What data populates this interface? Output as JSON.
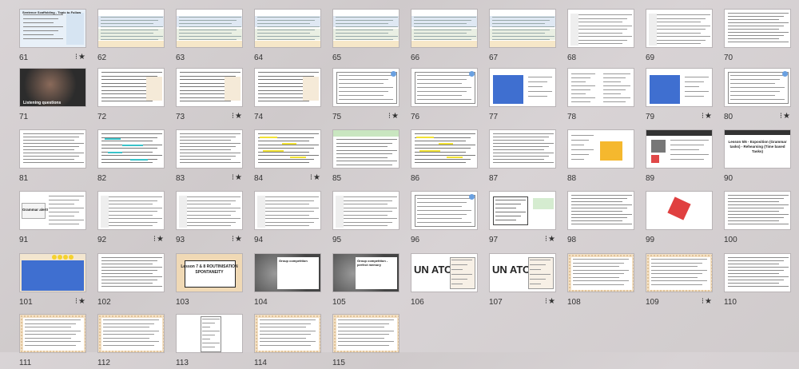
{
  "slides": [
    {
      "n": "61",
      "style": "table",
      "bg": "#e8f0f8",
      "title": "Sentence Scaffolding - Topic to Follow",
      "flag": "⁝★"
    },
    {
      "n": "62",
      "style": "bands",
      "bg": "#fff",
      "flag": ""
    },
    {
      "n": "63",
      "style": "bands",
      "bg": "#fff",
      "flag": ""
    },
    {
      "n": "64",
      "style": "bands",
      "bg": "#fff",
      "flag": ""
    },
    {
      "n": "65",
      "style": "bands",
      "bg": "#fff",
      "flag": ""
    },
    {
      "n": "66",
      "style": "bands",
      "bg": "#fff",
      "flag": ""
    },
    {
      "n": "67",
      "style": "bands",
      "bg": "#fff",
      "flag": ""
    },
    {
      "n": "68",
      "style": "rows",
      "bg": "#fff",
      "flag": ""
    },
    {
      "n": "69",
      "style": "rows",
      "bg": "#fff",
      "flag": ""
    },
    {
      "n": "70",
      "style": "text",
      "bg": "#fff",
      "flag": ""
    },
    {
      "n": "71",
      "style": "photo",
      "bg": "#3a3a3a",
      "title": "Listening questions",
      "flag": ""
    },
    {
      "n": "72",
      "style": "lines",
      "bg": "#fff",
      "flag": ""
    },
    {
      "n": "73",
      "style": "lines",
      "bg": "#fff",
      "flag": "⁝★"
    },
    {
      "n": "74",
      "style": "lines",
      "bg": "#fff",
      "flag": ""
    },
    {
      "n": "75",
      "style": "box",
      "bg": "#fff",
      "flag": "⁝★"
    },
    {
      "n": "76",
      "style": "box",
      "bg": "#fff",
      "flag": ""
    },
    {
      "n": "77",
      "style": "blue",
      "bg": "#fff",
      "flag": ""
    },
    {
      "n": "78",
      "style": "cols",
      "bg": "#fff",
      "flag": ""
    },
    {
      "n": "79",
      "style": "blue",
      "bg": "#fff",
      "flag": "⁝★"
    },
    {
      "n": "80",
      "style": "box",
      "bg": "#fff",
      "flag": "⁝★"
    },
    {
      "n": "81",
      "style": "text",
      "bg": "#fff",
      "flag": ""
    },
    {
      "n": "82",
      "style": "teal",
      "bg": "#fff",
      "flag": ""
    },
    {
      "n": "83",
      "style": "text",
      "bg": "#fff",
      "flag": "⁝★"
    },
    {
      "n": "84",
      "style": "yellow",
      "bg": "#fff",
      "flag": "⁝★"
    },
    {
      "n": "85",
      "style": "greenhead",
      "bg": "#fff",
      "flag": ""
    },
    {
      "n": "86",
      "style": "yellow",
      "bg": "#fff",
      "flag": ""
    },
    {
      "n": "87",
      "style": "text",
      "bg": "#fff",
      "flag": ""
    },
    {
      "n": "88",
      "style": "orange",
      "bg": "#fff",
      "flag": ""
    },
    {
      "n": "89",
      "style": "dice",
      "bg": "#fff",
      "flag": ""
    },
    {
      "n": "90",
      "style": "title",
      "bg": "#fff",
      "title": "Lesson 5/6 - Exposition (Grammar tasks) - Rehearsing (Time based Tasks)",
      "flag": ""
    },
    {
      "n": "91",
      "style": "grammar",
      "bg": "#fff",
      "title": "Grammar alert!",
      "flag": ""
    },
    {
      "n": "92",
      "style": "rows",
      "bg": "#fff",
      "flag": "⁝★"
    },
    {
      "n": "93",
      "style": "rows",
      "bg": "#fff",
      "flag": "⁝★"
    },
    {
      "n": "94",
      "style": "rows",
      "bg": "#fff",
      "flag": ""
    },
    {
      "n": "95",
      "style": "rows",
      "bg": "#fff",
      "flag": ""
    },
    {
      "n": "96",
      "style": "box",
      "bg": "#fff",
      "flag": ""
    },
    {
      "n": "97",
      "style": "greenbox",
      "bg": "#fff",
      "flag": "⁝★"
    },
    {
      "n": "98",
      "style": "text",
      "bg": "#fff",
      "flag": ""
    },
    {
      "n": "99",
      "style": "redcube",
      "bg": "#fff",
      "flag": ""
    },
    {
      "n": "100",
      "style": "text",
      "bg": "#fff",
      "flag": ""
    },
    {
      "n": "101",
      "style": "bigblue",
      "bg": "#f3e6cf",
      "flag": "⁝★"
    },
    {
      "n": "102",
      "style": "text",
      "bg": "#fff",
      "flag": ""
    },
    {
      "n": "103",
      "style": "lesson",
      "bg": "#f0d9b5",
      "title": "Lesson 7 & 8 ROUTINISATION SPONTANEITY",
      "flag": ""
    },
    {
      "n": "104",
      "style": "grey",
      "bg": "#7a7a7a",
      "title": "Group competition",
      "flag": ""
    },
    {
      "n": "105",
      "style": "grey",
      "bg": "#7a7a7a",
      "title": "Group competition - perfect memory",
      "flag": ""
    },
    {
      "n": "106",
      "style": "unatous",
      "bg": "#fff",
      "flag": ""
    },
    {
      "n": "107",
      "style": "unatous",
      "bg": "#fff",
      "flag": "⁝★"
    },
    {
      "n": "108",
      "style": "dotted",
      "bg": "#f3e0c4",
      "flag": ""
    },
    {
      "n": "109",
      "style": "dotted",
      "bg": "#f3e0c4",
      "flag": "⁝★"
    },
    {
      "n": "110",
      "style": "text",
      "bg": "#fff",
      "flag": ""
    },
    {
      "n": "111",
      "style": "dotted",
      "bg": "#f3e0c4",
      "flag": ""
    },
    {
      "n": "112",
      "style": "dotted",
      "bg": "#f3e0c4",
      "flag": ""
    },
    {
      "n": "113",
      "style": "doc",
      "bg": "#fff",
      "flag": ""
    },
    {
      "n": "114",
      "style": "dotted",
      "bg": "#f3e0c4",
      "flag": ""
    },
    {
      "n": "115",
      "style": "dotted",
      "bg": "#f3e0c4",
      "flag": ""
    }
  ]
}
